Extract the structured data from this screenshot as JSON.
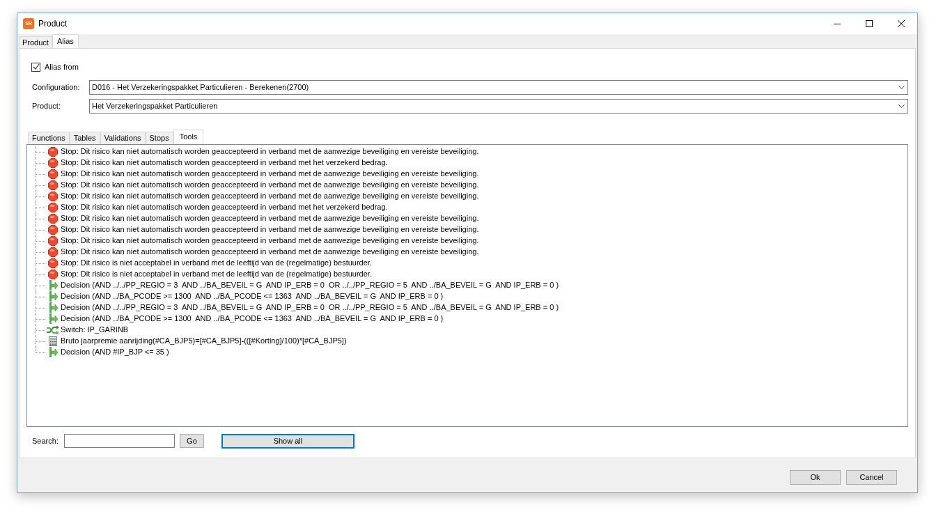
{
  "window": {
    "title": "Product",
    "app_badge": "SR"
  },
  "tabs": [
    {
      "label": "Product",
      "selected": false
    },
    {
      "label": "Alias",
      "selected": true
    }
  ],
  "alias_from": {
    "label": "Alias from",
    "checked": true
  },
  "fields": [
    {
      "label": "Configuration:",
      "value": "D016 - Het Verzekeringspakket Particulieren - Berekenen(2700)"
    },
    {
      "label": "Product:",
      "value": "Het Verzekeringspakket Particulieren"
    }
  ],
  "inner_tabs": [
    {
      "label": "Functions",
      "selected": false
    },
    {
      "label": "Tables",
      "selected": false
    },
    {
      "label": "Validations",
      "selected": false
    },
    {
      "label": "Stops",
      "selected": false
    },
    {
      "label": "Tools",
      "selected": true
    }
  ],
  "tree": [
    {
      "kind": "stop",
      "text": "Stop: Dit risico kan niet automatisch worden geaccepteerd in verband met de aanwezige beveiliging en vereiste beveiliging."
    },
    {
      "kind": "stop",
      "text": "Stop: Dit risico kan niet automatisch worden geaccepteerd in verband met het verzekerd bedrag."
    },
    {
      "kind": "stop",
      "text": "Stop: Dit risico kan niet automatisch worden geaccepteerd in verband met de aanwezige beveiliging en vereiste beveiliging."
    },
    {
      "kind": "stop",
      "text": "Stop: Dit risico kan niet automatisch worden geaccepteerd in verband met de aanwezige beveiliging en vereiste beveiliging."
    },
    {
      "kind": "stop",
      "text": "Stop: Dit risico kan niet automatisch worden geaccepteerd in verband met de aanwezige beveiliging en vereiste beveiliging."
    },
    {
      "kind": "stop",
      "text": "Stop: Dit risico kan niet automatisch worden geaccepteerd in verband met het verzekerd bedrag."
    },
    {
      "kind": "stop",
      "text": "Stop: Dit risico kan niet automatisch worden geaccepteerd in verband met de aanwezige beveiliging en vereiste beveiliging."
    },
    {
      "kind": "stop",
      "text": "Stop: Dit risico kan niet automatisch worden geaccepteerd in verband met de aanwezige beveiliging en vereiste beveiliging."
    },
    {
      "kind": "stop",
      "text": "Stop: Dit risico kan niet automatisch worden geaccepteerd in verband met de aanwezige beveiliging en vereiste beveiliging."
    },
    {
      "kind": "stop",
      "text": "Stop: Dit risico kan niet automatisch worden geaccepteerd in verband met de aanwezige beveiliging en vereiste beveiliging."
    },
    {
      "kind": "stop",
      "text": "Stop: Dit risico is niet acceptabel in verband met de leeftijd van de (regelmatige) bestuurder."
    },
    {
      "kind": "stop",
      "text": "Stop: Dit risico is niet acceptabel in verband met de leeftijd van de (regelmatige) bestuurder."
    },
    {
      "kind": "decision",
      "text": "Decision (AND ../../PP_REGIO = 3  AND ../BA_BEVEIL = G  AND IP_ERB = 0  OR ../../PP_REGIO = 5  AND ../BA_BEVEIL = G  AND IP_ERB = 0 )"
    },
    {
      "kind": "decision",
      "text": "Decision (AND ../BA_PCODE >= 1300  AND ../BA_PCODE <= 1363  AND ../BA_BEVEIL = G  AND IP_ERB = 0 )"
    },
    {
      "kind": "decision",
      "text": "Decision (AND ../../PP_REGIO = 3  AND ../BA_BEVEIL = G  AND IP_ERB = 0  OR ../../PP_REGIO = 5  AND ../BA_BEVEIL = G  AND IP_ERB = 0 )"
    },
    {
      "kind": "decision",
      "text": "Decision (AND ../BA_PCODE >= 1300  AND ../BA_PCODE <= 1363  AND ../BA_BEVEIL = G  AND IP_ERB = 0 )"
    },
    {
      "kind": "switch",
      "text": "Switch: IP_GARINB"
    },
    {
      "kind": "formula",
      "text": "Bruto jaarpremie aanrijding(#CA_BJP5)=[#CA_BJP5]-(([#Korting]/100)*[#CA_BJP5])"
    },
    {
      "kind": "decision",
      "text": "Decision (AND #IP_BJP <= 35 )"
    }
  ],
  "search": {
    "label": "Search:",
    "go": "Go",
    "show_all": "Show all",
    "show_all_focused": true
  },
  "footer_buttons": [
    "Ok",
    "Cancel"
  ]
}
